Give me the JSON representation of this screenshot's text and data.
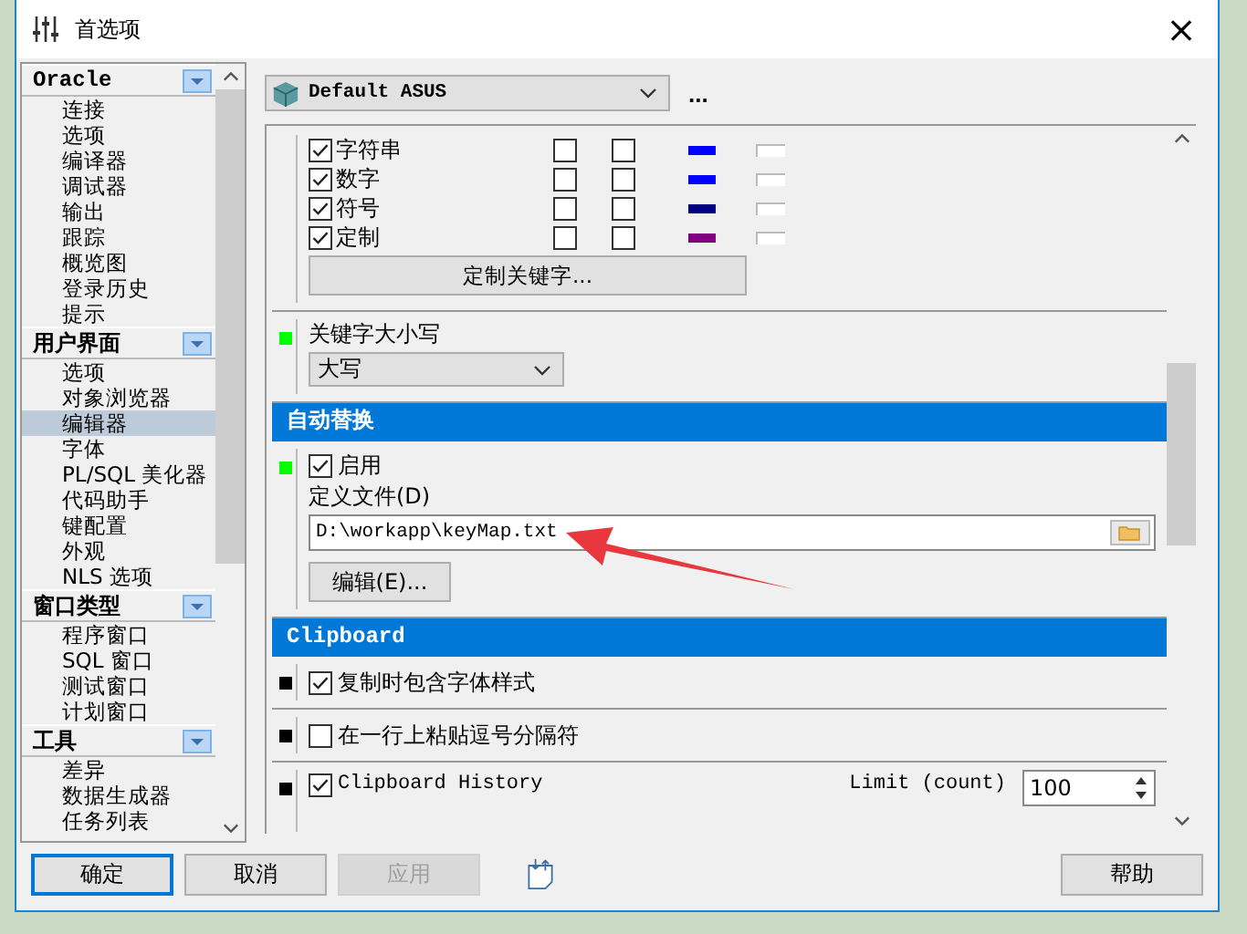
{
  "window": {
    "title": "首选项",
    "close": "×"
  },
  "nav": [
    {
      "title": "Oracle",
      "items": [
        {
          "label": "连接",
          "selected": false
        },
        {
          "label": "选项",
          "selected": false
        },
        {
          "label": "编译器",
          "selected": false
        },
        {
          "label": "调试器",
          "selected": false
        },
        {
          "label": "输出",
          "selected": false
        },
        {
          "label": "跟踪",
          "selected": false
        },
        {
          "label": "概览图",
          "selected": false
        },
        {
          "label": "登录历史",
          "selected": false
        },
        {
          "label": "提示",
          "selected": false
        }
      ]
    },
    {
      "title": "用户界面",
      "items": [
        {
          "label": "选项",
          "selected": false
        },
        {
          "label": "对象浏览器",
          "selected": false
        },
        {
          "label": "编辑器",
          "selected": true
        },
        {
          "label": "字体",
          "selected": false
        },
        {
          "label": "PL/SQL 美化器",
          "selected": false
        },
        {
          "label": "代码助手",
          "selected": false
        },
        {
          "label": "键配置",
          "selected": false
        },
        {
          "label": "外观",
          "selected": false
        },
        {
          "label": "NLS 选项",
          "selected": false
        }
      ]
    },
    {
      "title": "窗口类型",
      "items": [
        {
          "label": "程序窗口",
          "selected": false
        },
        {
          "label": "SQL 窗口",
          "selected": false
        },
        {
          "label": "测试窗口",
          "selected": false
        },
        {
          "label": "计划窗口",
          "selected": false
        }
      ]
    },
    {
      "title": "工具",
      "items": [
        {
          "label": "差异",
          "selected": false
        },
        {
          "label": "数据生成器",
          "selected": false
        },
        {
          "label": "任务列表",
          "selected": false
        }
      ]
    }
  ],
  "profile": {
    "value": "Default ASUS",
    "more_button": "..."
  },
  "syntax": [
    {
      "label": "字符串",
      "checked": true,
      "bold": false,
      "italic": false,
      "color": "#0000ff"
    },
    {
      "label": "数字",
      "checked": true,
      "bold": false,
      "italic": false,
      "color": "#0000ff"
    },
    {
      "label": "符号",
      "checked": true,
      "bold": false,
      "italic": false,
      "color": "#000080"
    },
    {
      "label": "定制",
      "checked": true,
      "bold": false,
      "italic": false,
      "color": "#800080"
    }
  ],
  "custom_keywords_button": "定制关键字...",
  "keyword_case": {
    "color": "#00ff00",
    "label": "关键字大小写",
    "value": "大写"
  },
  "auto_replace": {
    "header": "自动替换",
    "color": "#00ff00",
    "enable": {
      "label": "启用",
      "checked": true
    },
    "file_label": "定义文件(D)",
    "file": "D:\\workapp\\keyMap.txt",
    "edit_button": "编辑(E)..."
  },
  "clipboard": {
    "header": "Clipboard",
    "options": [
      {
        "label": "复制时包含字体样式",
        "checked": true,
        "color": "#000000"
      },
      {
        "label": "在一行上粘贴逗号分隔符",
        "checked": false,
        "color": "#000000"
      },
      {
        "label": "Clipboard History",
        "checked": true,
        "color": "#000000",
        "limit_label": "Limit (count)",
        "limit": "100"
      }
    ]
  },
  "buttons": [
    {
      "label": "确定",
      "kind": "default",
      "disabled": false
    },
    {
      "label": "取消",
      "kind": "normal",
      "disabled": false
    },
    {
      "label": "应用",
      "kind": "normal",
      "disabled": true
    }
  ],
  "help_button": "帮助"
}
